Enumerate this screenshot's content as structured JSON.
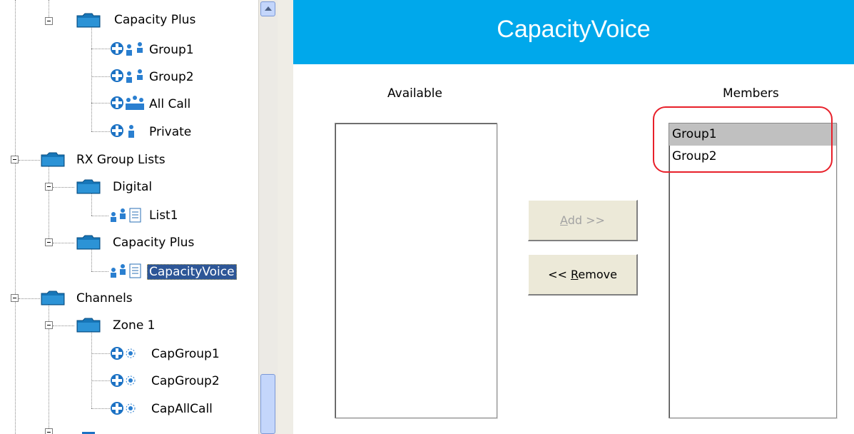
{
  "tree": {
    "nodes": [
      {
        "label": "Capacity Plus",
        "icon": "folder-icon"
      },
      {
        "label": "Group1",
        "icon": "talkgroup-icon"
      },
      {
        "label": "Group2",
        "icon": "talkgroup-icon"
      },
      {
        "label": "All Call",
        "icon": "all-call-icon"
      },
      {
        "label": "Private",
        "icon": "private-call-icon"
      },
      {
        "label": "RX Group Lists",
        "icon": "folder-icon"
      },
      {
        "label": "Digital",
        "icon": "folder-icon"
      },
      {
        "label": "List1",
        "icon": "rx-list-icon"
      },
      {
        "label": "Capacity Plus",
        "icon": "folder-icon"
      },
      {
        "label": "CapacityVoice",
        "icon": "rx-list-icon",
        "selected": true
      },
      {
        "label": "Channels",
        "icon": "folder-icon"
      },
      {
        "label": "Zone 1",
        "icon": "folder-icon"
      },
      {
        "label": "CapGroup1",
        "icon": "channel-icon"
      },
      {
        "label": "CapGroup2",
        "icon": "channel-icon"
      },
      {
        "label": "CapAllCall",
        "icon": "channel-icon"
      }
    ]
  },
  "panel": {
    "title": "CapacityVoice",
    "available_label": "Available",
    "members_label": "Members",
    "available_items": [],
    "members": [
      "Group1",
      "Group2"
    ],
    "add_button": {
      "accesskey": "A",
      "rest": "dd >>",
      "enabled": false
    },
    "remove_button": {
      "prefix": "<< ",
      "accesskey": "R",
      "rest": "emove",
      "enabled": true
    }
  },
  "colors": {
    "header_bg": "#00a8eb",
    "selection_bg": "#2d5697",
    "highlight_ring": "#e8202a"
  }
}
